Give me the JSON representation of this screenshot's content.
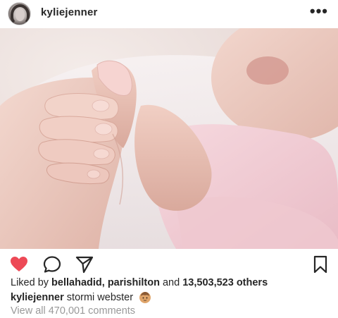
{
  "post": {
    "username": "kyliejenner",
    "more_icon": "•••",
    "icons": [
      "heart-icon",
      "comment-icon",
      "share-icon",
      "bookmark-icon"
    ],
    "colors": {
      "heart": "#ed4956",
      "text": "#262626",
      "muted": "#999999"
    },
    "likes": {
      "prefix": "Liked by",
      "user1": "bellahadid",
      "separator": ",",
      "user2": "parishilton",
      "and_text": "and",
      "others": "13,503,523 others"
    },
    "caption": {
      "username": "kyliejenner",
      "text": "stormi webster"
    },
    "comments_link": "View all 470,001 comments"
  }
}
